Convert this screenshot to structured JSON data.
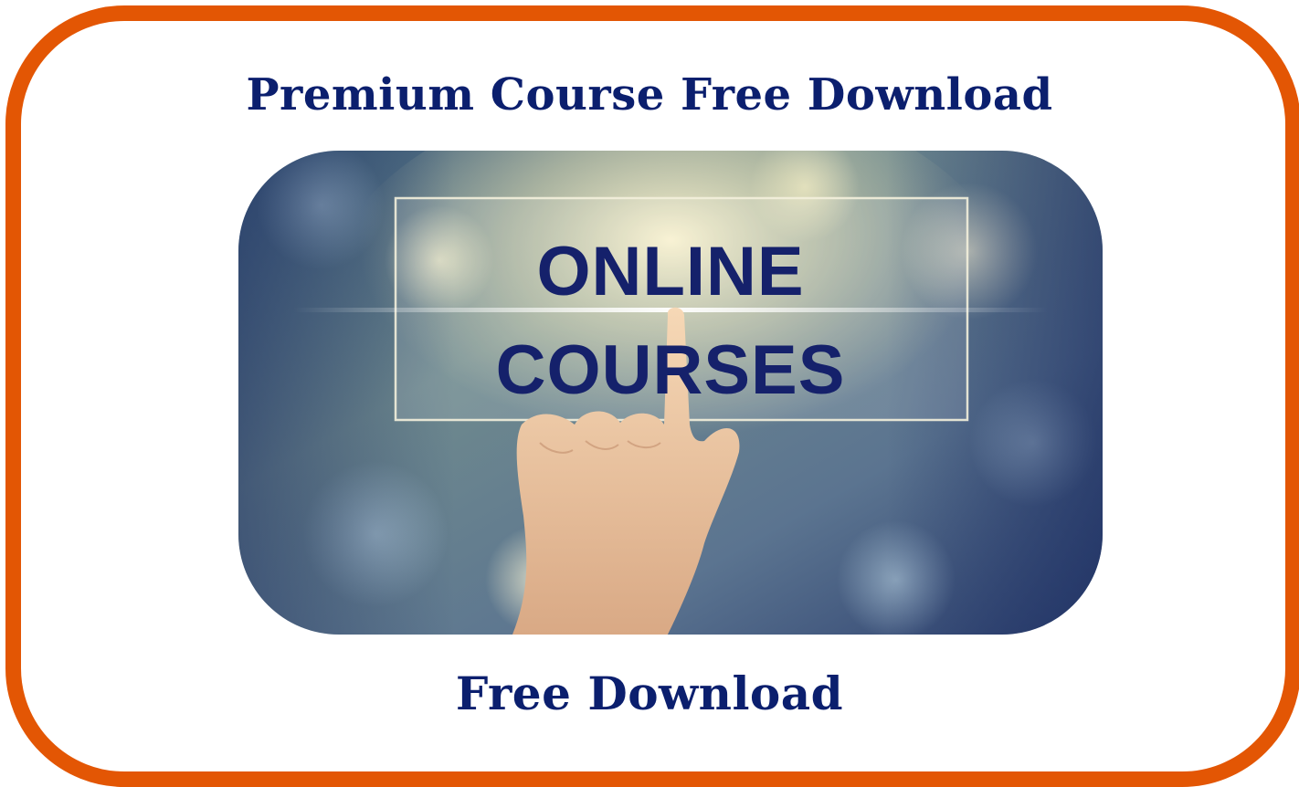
{
  "header": {
    "title": "Premium Course Free Download"
  },
  "banner": {
    "image_name": "online-courses-image",
    "line1": "ONLINE",
    "line2": "COURSES",
    "colors": {
      "text": "#15216b",
      "frame": "#e35604",
      "heading": "#0b1f6e"
    }
  },
  "footer": {
    "label": "Free Download"
  }
}
